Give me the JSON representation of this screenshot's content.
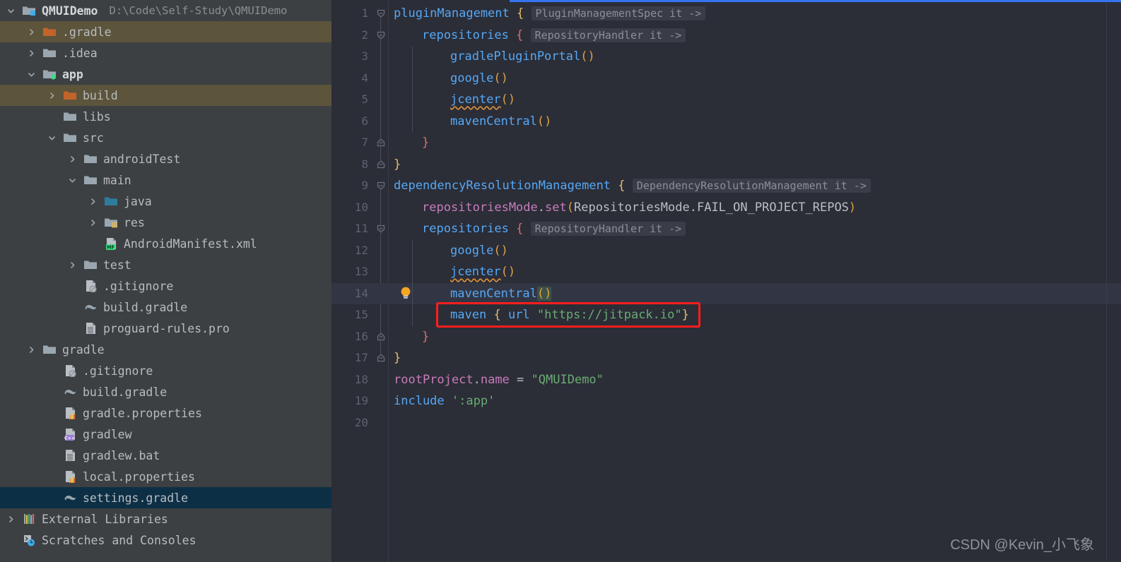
{
  "project": {
    "name": "QMUIDemo",
    "path": "D:\\Code\\Self-Study\\QMUIDemo",
    "icon": "module-folder-icon"
  },
  "sidebar": {
    "items": [
      {
        "label": "QMUIDemo",
        "path": "D:\\Code\\Self-Study\\QMUIDemo",
        "indent": 0,
        "arrow": "down",
        "icon": "module-folder-icon",
        "state": "bold"
      },
      {
        "label": ".gradle",
        "indent": 1,
        "arrow": "right",
        "icon": "folder-orange-icon",
        "state": "excluded"
      },
      {
        "label": ".idea",
        "indent": 1,
        "arrow": "right",
        "icon": "folder-icon",
        "state": "normal"
      },
      {
        "label": "app",
        "indent": 1,
        "arrow": "down",
        "icon": "module-green-icon",
        "state": "bold"
      },
      {
        "label": "build",
        "indent": 2,
        "arrow": "right",
        "icon": "folder-orange-icon",
        "state": "excluded"
      },
      {
        "label": "libs",
        "indent": 2,
        "arrow": "none",
        "icon": "folder-icon",
        "state": "normal"
      },
      {
        "label": "src",
        "indent": 2,
        "arrow": "down",
        "icon": "folder-icon",
        "state": "normal"
      },
      {
        "label": "androidTest",
        "indent": 3,
        "arrow": "right",
        "icon": "folder-icon",
        "state": "normal"
      },
      {
        "label": "main",
        "indent": 3,
        "arrow": "down",
        "icon": "folder-icon",
        "state": "normal"
      },
      {
        "label": "java",
        "indent": 4,
        "arrow": "right",
        "icon": "folder-source-icon",
        "state": "normal"
      },
      {
        "label": "res",
        "indent": 4,
        "arrow": "right",
        "icon": "folder-resource-icon",
        "state": "normal"
      },
      {
        "label": "AndroidManifest.xml",
        "indent": 4,
        "arrow": "none",
        "icon": "manifest-file-icon",
        "state": "normal"
      },
      {
        "label": "test",
        "indent": 3,
        "arrow": "right",
        "icon": "folder-icon",
        "state": "normal"
      },
      {
        "label": ".gitignore",
        "indent": 3,
        "arrow": "none",
        "icon": "gitignore-file-icon",
        "state": "normal"
      },
      {
        "label": "build.gradle",
        "indent": 3,
        "arrow": "none",
        "icon": "gradle-file-icon",
        "state": "normal"
      },
      {
        "label": "proguard-rules.pro",
        "indent": 3,
        "arrow": "none",
        "icon": "text-file-icon",
        "state": "normal"
      },
      {
        "label": "gradle",
        "indent": 1,
        "arrow": "right",
        "icon": "folder-icon",
        "state": "normal"
      },
      {
        "label": ".gitignore",
        "indent": 2,
        "arrow": "none",
        "icon": "gitignore-file-icon",
        "state": "normal"
      },
      {
        "label": "build.gradle",
        "indent": 2,
        "arrow": "none",
        "icon": "gradle-file-icon",
        "state": "normal"
      },
      {
        "label": "gradle.properties",
        "indent": 2,
        "arrow": "none",
        "icon": "properties-file-icon",
        "state": "normal"
      },
      {
        "label": "gradlew",
        "indent": 2,
        "arrow": "none",
        "icon": "cpp-file-icon",
        "state": "normal"
      },
      {
        "label": "gradlew.bat",
        "indent": 2,
        "arrow": "none",
        "icon": "text-file-icon",
        "state": "normal"
      },
      {
        "label": "local.properties",
        "indent": 2,
        "arrow": "none",
        "icon": "properties-file-icon",
        "state": "normal"
      },
      {
        "label": "settings.gradle",
        "indent": 2,
        "arrow": "none",
        "icon": "gradle-file-icon",
        "state": "selected"
      },
      {
        "label": "External Libraries",
        "indent": 0,
        "arrow": "right",
        "icon": "libraries-icon",
        "state": "normal"
      },
      {
        "label": "Scratches and Consoles",
        "indent": 0,
        "arrow": "none",
        "icon": "scratches-icon",
        "state": "normal"
      }
    ]
  },
  "editor": {
    "filename": "settings.gradle",
    "current_line": 14,
    "total_lines": 20,
    "lines": [
      {
        "n": 1,
        "indent": 0
      },
      {
        "n": 2,
        "indent": 1
      },
      {
        "n": 3,
        "indent": 2
      },
      {
        "n": 4,
        "indent": 2
      },
      {
        "n": 5,
        "indent": 2
      },
      {
        "n": 6,
        "indent": 2
      },
      {
        "n": 7,
        "indent": 1
      },
      {
        "n": 8,
        "indent": 0
      },
      {
        "n": 9,
        "indent": 0
      },
      {
        "n": 10,
        "indent": 1
      },
      {
        "n": 11,
        "indent": 1
      },
      {
        "n": 12,
        "indent": 2
      },
      {
        "n": 13,
        "indent": 2
      },
      {
        "n": 14,
        "indent": 2
      },
      {
        "n": 15,
        "indent": 2
      },
      {
        "n": 16,
        "indent": 1
      },
      {
        "n": 17,
        "indent": 0
      },
      {
        "n": 18,
        "indent": 0
      },
      {
        "n": 19,
        "indent": 0
      },
      {
        "n": 20,
        "indent": 0
      }
    ],
    "code": {
      "l1_name": "pluginManagement",
      "l1_brace": "{",
      "l1_hint": "PluginManagementSpec it ->",
      "l2_name": "repositories",
      "l2_brace": "{",
      "l2_hint": "RepositoryHandler it ->",
      "l3_name": "gradlePluginPortal",
      "l3_parens": "()",
      "l4_name": "google",
      "l4_parens": "()",
      "l5_name": "jcenter",
      "l5_parens": "()",
      "l6_name": "mavenCentral",
      "l6_parens": "()",
      "l7_brace": "}",
      "l8_brace": "}",
      "l9_name": "dependencyResolutionManagement",
      "l9_brace": "{",
      "l9_hint": "DependencyResolutionManagement it ->",
      "l10_obj": "repositoriesMode",
      "l10_dot": ".",
      "l10_call": "set",
      "l10_open": "(",
      "l10_arg": "RepositoriesMode.FAIL_ON_PROJECT_REPOS",
      "l10_close": ")",
      "l11_name": "repositories",
      "l11_brace": "{",
      "l11_hint": "RepositoryHandler it ->",
      "l12_name": "google",
      "l12_parens": "()",
      "l13_name": "jcenter",
      "l13_parens": "()",
      "l14_name": "mavenCentral",
      "l14_parens": "()",
      "l15_kw": "maven",
      "l15_open": "{",
      "l15_url_kw": "url",
      "l15_url": "\"https://jitpack.io\"",
      "l15_close": "}",
      "l16_brace": "}",
      "l17_brace": "}",
      "l18_obj": "rootProject",
      "l18_dot": ".",
      "l18_prop": "name",
      "l18_eq": "=",
      "l18_val": "\"QMUIDemo\"",
      "l19_kw": "include",
      "l19_val": "':app'"
    },
    "annotation": {
      "type": "red-rectangle",
      "target_line": 15,
      "color": "#ff1e1e"
    },
    "gutter_icon": {
      "line": 14,
      "name": "intention-bulb-icon"
    }
  },
  "watermark": {
    "text": "CSDN @Kevin_小飞象"
  },
  "colors": {
    "sidebar_bg": "#3c4043",
    "editor_bg": "#2b2d37",
    "selected_row": "#0d2f45",
    "excluded_row": "#5c543b",
    "accent_blue": "#3574f0",
    "annotation_red": "#ff1e1e",
    "string_green": "#6aab73",
    "function_blue": "#56a8f5"
  }
}
